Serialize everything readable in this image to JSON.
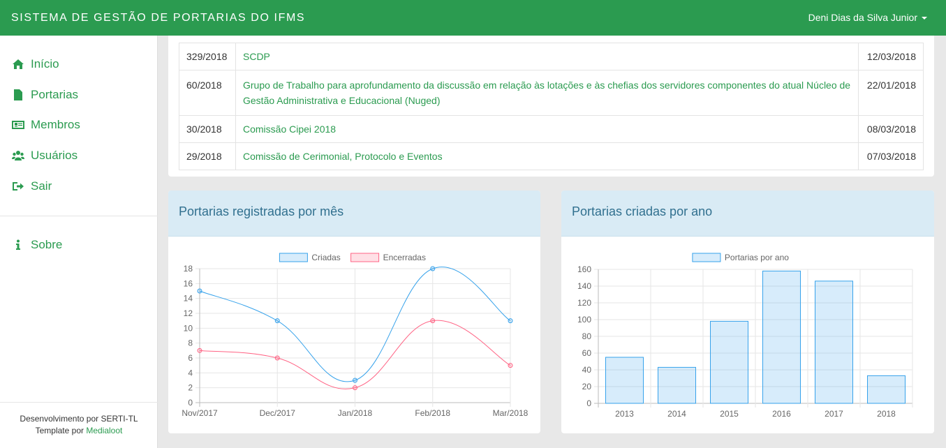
{
  "header": {
    "title": "SISTEMA DE GESTÃO DE PORTARIAS DO IFMS",
    "user": "Deni Dias da Silva Junior"
  },
  "sidebar": {
    "items": [
      {
        "label": "Início",
        "icon": "home-icon"
      },
      {
        "label": "Portarias",
        "icon": "file-icon"
      },
      {
        "label": "Membros",
        "icon": "id-card-icon"
      },
      {
        "label": "Usuários",
        "icon": "users-icon"
      },
      {
        "label": "Sair",
        "icon": "sign-out-icon"
      }
    ],
    "about": {
      "label": "Sobre",
      "icon": "info-icon"
    },
    "footer": {
      "dev": "Desenvolvimento por SERTI-TL",
      "template_prefix": "Template por ",
      "template_link": "Medialoot"
    }
  },
  "table": {
    "rows": [
      {
        "num": "329/2018",
        "desc": "SCDP",
        "date": "12/03/2018"
      },
      {
        "num": "60/2018",
        "desc": "Grupo de Trabalho para aprofundamento da discussão em relação às lotações e às chefias dos servidores componentes do atual Núcleo de Gestão Administrativa e Educacional (Nuged)",
        "date": "22/01/2018"
      },
      {
        "num": "30/2018",
        "desc": "Comissão Cipei 2018",
        "date": "08/03/2018"
      },
      {
        "num": "29/2018",
        "desc": "Comissão de Cerimonial, Protocolo e Eventos",
        "date": "07/03/2018"
      }
    ]
  },
  "cards": {
    "monthly_title": "Portarias registradas por mês",
    "yearly_title": "Portarias criadas por ano"
  },
  "colors": {
    "brand": "#2b9b50",
    "series_blue": "#36a2eb",
    "series_red": "#ff6384",
    "card_header": "#d9ebf5"
  },
  "chart_data": [
    {
      "type": "line",
      "categories": [
        "Nov/2017",
        "Dec/2017",
        "Jan/2018",
        "Feb/2018",
        "Mar/2018"
      ],
      "series": [
        {
          "name": "Criadas",
          "values": [
            15,
            11,
            3,
            18,
            11
          ],
          "color": "#36a2eb"
        },
        {
          "name": "Encerradas",
          "values": [
            7,
            6,
            2,
            11,
            5
          ],
          "color": "#ff6384"
        }
      ],
      "ylim": [
        0,
        18
      ],
      "yticks": [
        0,
        2,
        4,
        6,
        8,
        10,
        12,
        14,
        16,
        18
      ],
      "grid": true,
      "legend": "top"
    },
    {
      "type": "bar",
      "categories": [
        "2013",
        "2014",
        "2015",
        "2016",
        "2017",
        "2018"
      ],
      "series": [
        {
          "name": "Portarias por ano",
          "values": [
            55,
            43,
            98,
            158,
            146,
            33
          ],
          "color": "#36a2eb"
        }
      ],
      "ylim": [
        0,
        160
      ],
      "yticks": [
        0,
        20,
        40,
        60,
        80,
        100,
        120,
        140,
        160
      ],
      "grid": true,
      "legend": "top"
    }
  ]
}
